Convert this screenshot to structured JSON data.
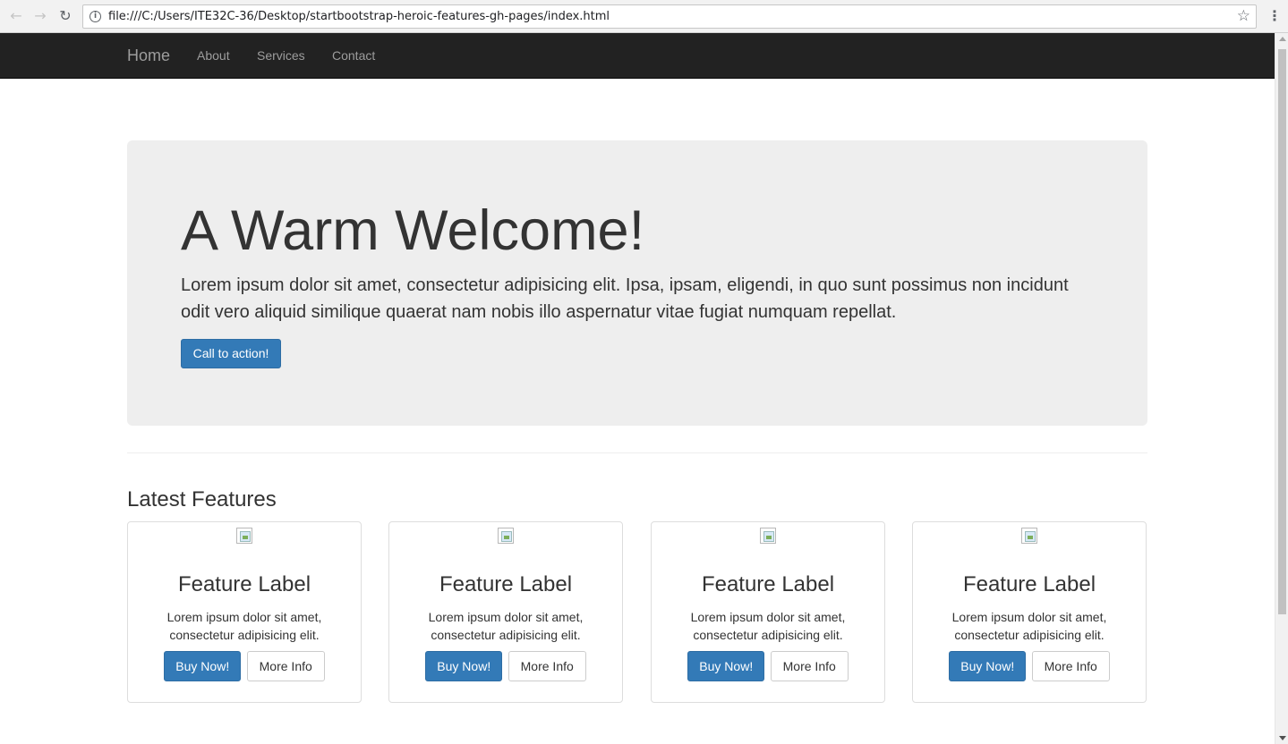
{
  "browser": {
    "url": "file:///C:/Users/ITE32C-36/Desktop/startbootstrap-heroic-features-gh-pages/index.html",
    "back_icon": "arrow-left",
    "forward_icon": "arrow-right",
    "reload_icon": "reload"
  },
  "navbar": {
    "brand": "Home",
    "links": [
      "About",
      "Services",
      "Contact"
    ]
  },
  "jumbotron": {
    "title": "A Warm Welcome!",
    "text": "Lorem ipsum dolor sit amet, consectetur adipisicing elit. Ipsa, ipsam, eligendi, in quo sunt possimus non incidunt odit vero aliquid similique quaerat nam nobis illo aspernatur vitae fugiat numquam repellat.",
    "cta_label": "Call to action!"
  },
  "features": {
    "title": "Latest Features",
    "cards": [
      {
        "label": "Feature Label",
        "text": "Lorem ipsum dolor sit amet, consectetur adipisicing elit.",
        "buy_label": "Buy Now!",
        "info_label": "More Info"
      },
      {
        "label": "Feature Label",
        "text": "Lorem ipsum dolor sit amet, consectetur adipisicing elit.",
        "buy_label": "Buy Now!",
        "info_label": "More Info"
      },
      {
        "label": "Feature Label",
        "text": "Lorem ipsum dolor sit amet, consectetur adipisicing elit.",
        "buy_label": "Buy Now!",
        "info_label": "More Info"
      },
      {
        "label": "Feature Label",
        "text": "Lorem ipsum dolor sit amet, consectetur adipisicing elit.",
        "buy_label": "Buy Now!",
        "info_label": "More Info"
      }
    ]
  },
  "colors": {
    "navbar_bg": "#222222",
    "primary": "#337ab7",
    "jumbotron_bg": "#eeeeee"
  }
}
